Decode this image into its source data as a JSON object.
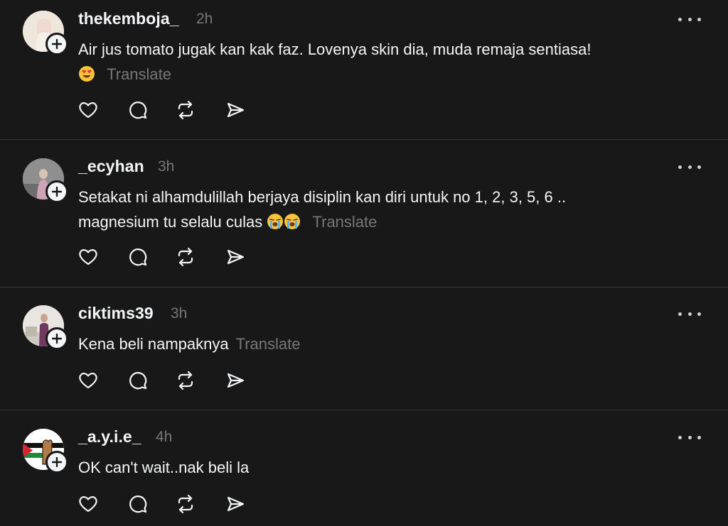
{
  "posts": [
    {
      "username": "thekemboja_",
      "time": "2h",
      "text": "Air jus tomato jugak kan kak faz. Lovenya skin dia, muda remaja sentiasa!",
      "emoji": [
        "heart-eyes"
      ],
      "translate": "Translate"
    },
    {
      "username": "_ecyhan",
      "time": "3h",
      "text_line1": "Setakat ni alhamdulillah berjaya disiplin kan diri untuk no 1, 2, 3, 5, 6 ..",
      "text_line2": "magnesium tu selalu culas",
      "emoji": [
        "loudly-crying",
        "loudly-crying"
      ],
      "translate": "Translate"
    },
    {
      "username": "ciktims39",
      "time": "3h",
      "text": "Kena beli nampaknya",
      "translate": "Translate"
    },
    {
      "username": "_a.y.i.e_",
      "time": "4h",
      "text": "OK can't wait..nak beli la"
    }
  ],
  "icons": {
    "like": "heart-icon",
    "reply": "comment-icon",
    "repost": "repost-icon",
    "share": "send-icon",
    "more": "more-icon",
    "follow": "plus-icon"
  },
  "colors": {
    "background": "#181818",
    "text": "#f3f5f7",
    "muted": "#777777",
    "divider": "#333638"
  }
}
